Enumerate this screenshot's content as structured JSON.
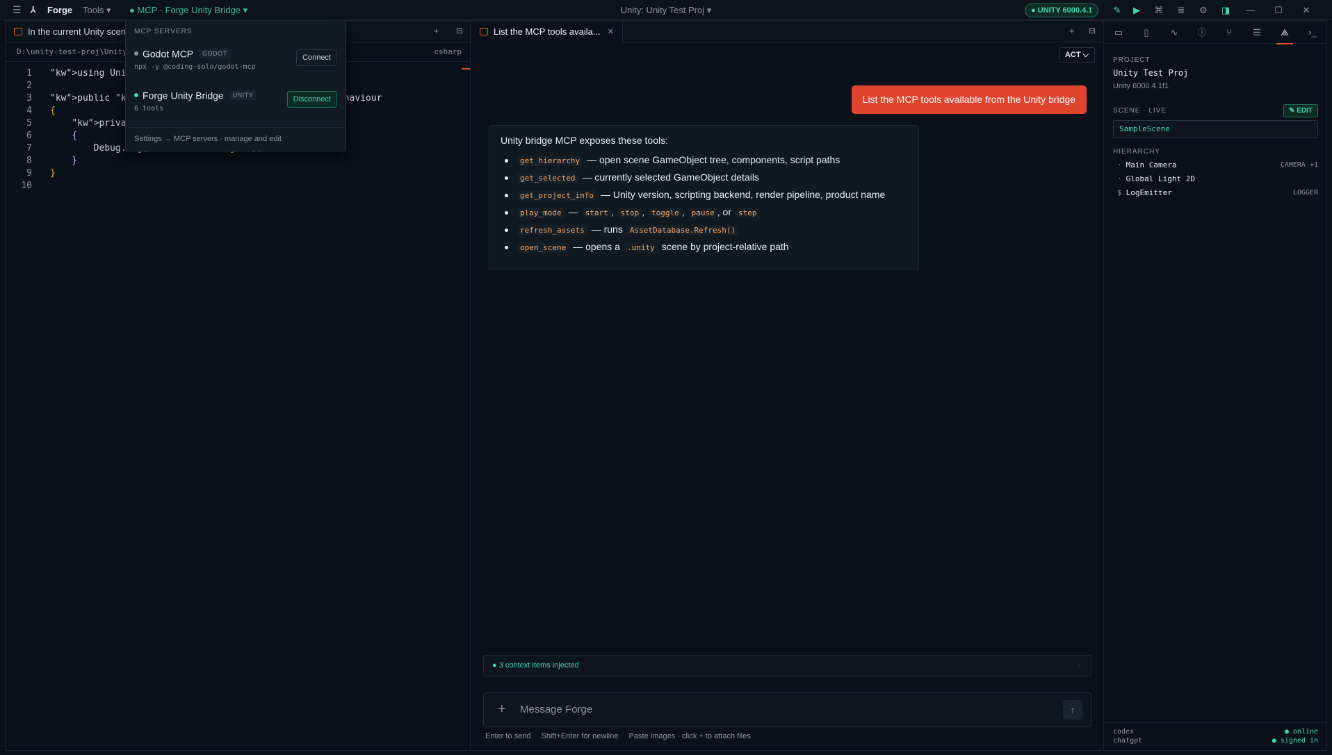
{
  "titlebar": {
    "app_name": "Forge",
    "tools_label": "Tools ▾",
    "mcp_label": "● MCP · Forge Unity Bridge ▾",
    "window_title": "Unity: Unity Test Proj ▾",
    "unity_badge": "● UNITY 6000.4.1"
  },
  "editor": {
    "tab_label": "In the current Unity scene",
    "path": "D:\\unity-test-proj\\Unity",
    "language": "csharp",
    "lines": [
      {
        "n": "1",
        "text": "using UnityEngine;"
      },
      {
        "n": "2",
        "text": ""
      },
      {
        "n": "3",
        "text": "public sealed class LogEmitter : MonoBehaviour"
      },
      {
        "n": "4",
        "text": "{"
      },
      {
        "n": "5",
        "text": "    private void Start()"
      },
      {
        "n": "6",
        "text": "    {"
      },
      {
        "n": "7",
        "text": "        Debug.Log(\"Hello from Forge!\");"
      },
      {
        "n": "8",
        "text": "    }"
      },
      {
        "n": "9",
        "text": "}"
      },
      {
        "n": "10",
        "text": ""
      }
    ]
  },
  "mcp_dropdown": {
    "header": "MCP SERVERS",
    "servers": [
      {
        "name": "Godot MCP",
        "tag": "GODOT",
        "sub": "npx -y @coding-solo/godot-mcp",
        "action": "Connect",
        "status_color": "#8b949e"
      },
      {
        "name": "Forge Unity Bridge",
        "tag": "UNITY",
        "sub": "6 tools",
        "action": "Disconnect",
        "status_color": "#3fd6b1"
      }
    ],
    "footer": "Settings → MCP servers · manage and edit"
  },
  "chat": {
    "tab_label": "List the MCP tools availa...",
    "mode": "ACT ⌵",
    "user_message": "List the MCP tools available from the Unity bridge",
    "assistant_heading": "Unity bridge MCP exposes these tools:",
    "tools": [
      {
        "code": "get_hierarchy",
        "desc": "— open scene GameObject tree, components, script paths"
      },
      {
        "code": "get_selected",
        "desc": "— currently selected GameObject details"
      },
      {
        "code": "get_project_info",
        "desc": "— Unity version, scripting backend, render pipeline, product name"
      },
      {
        "code": "play_mode",
        "desc": "—",
        "args": [
          "start",
          "stop",
          "toggle",
          "pause",
          "step"
        ]
      },
      {
        "code": "refresh_assets",
        "desc": "— runs",
        "extra_code": "AssetDatabase.Refresh()"
      },
      {
        "code": "open_scene",
        "desc": "— opens a",
        "extra_code": ".unity",
        "tail": "scene by project-relative path"
      }
    ],
    "context_note": "● 3 context items injected",
    "compose_placeholder": "Message Forge",
    "hints": [
      "Enter to send",
      "Shift+Enter for newline",
      "Paste images · click + to attach files"
    ]
  },
  "right_panel": {
    "project_label": "PROJECT",
    "project_name": "Unity Test Proj",
    "project_version": "Unity 6000.4.1f1",
    "scene_label": "SCENE · LIVE",
    "edit_label": "✎ EDIT",
    "scene_value": "SampleScene",
    "hierarchy_label": "HIERARCHY",
    "hierarchy": [
      {
        "mark": "·",
        "name": "Main Camera",
        "tag": "CAMERA +1"
      },
      {
        "mark": "·",
        "name": "Global Light 2D",
        "tag": ""
      },
      {
        "mark": "$",
        "name": "LogEmitter",
        "tag": "LOGGER"
      }
    ],
    "footer": {
      "left1": "codex",
      "left2": "chatgpt",
      "right1": "● online",
      "right2": "● signed in"
    }
  },
  "colors": {
    "accent": "#e0442e",
    "teal": "#3fd6b1",
    "bg": "#0b111a"
  }
}
